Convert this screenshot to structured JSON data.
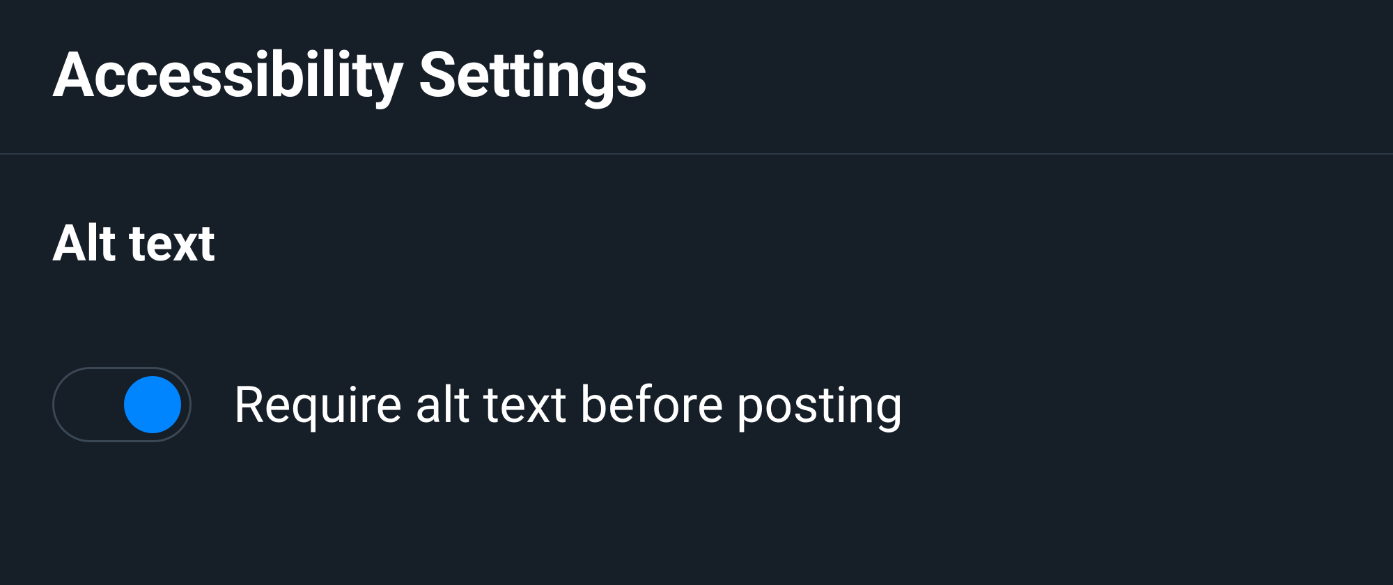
{
  "page": {
    "title": "Accessibility Settings"
  },
  "section": {
    "alt_text": {
      "heading": "Alt text",
      "settings": {
        "require_alt_text": {
          "label": "Require alt text before posting",
          "enabled": true
        }
      }
    }
  },
  "colors": {
    "background": "#161e27",
    "text": "#ffffff",
    "divider": "#2e3a47",
    "toggle_border": "#3a4755",
    "toggle_active": "#0085ff"
  }
}
